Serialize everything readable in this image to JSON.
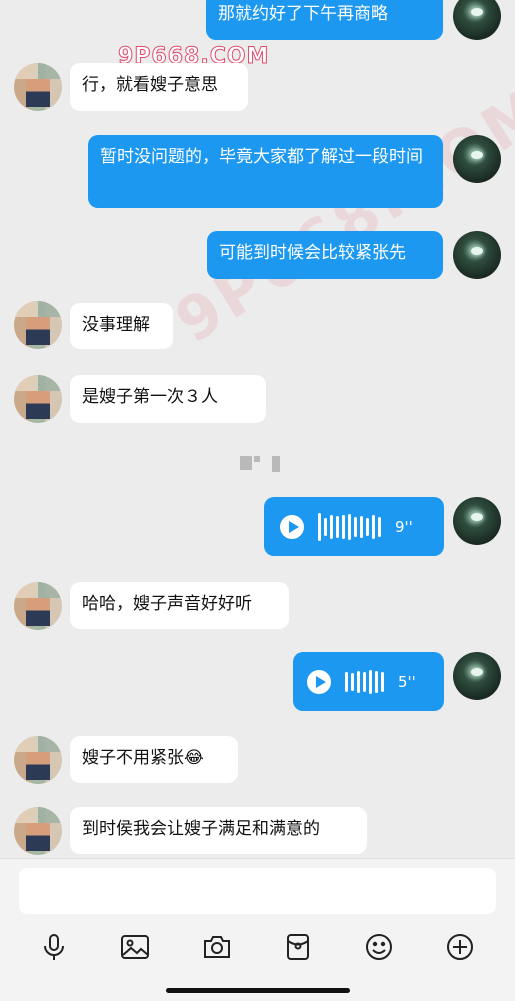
{
  "messages": [
    {
      "side": "out",
      "text": "那就约好了下午再商略"
    },
    {
      "side": "in",
      "text": "行，就看嫂子意思"
    },
    {
      "side": "out",
      "text": "暂时没问题的，毕竟大家都了解过一段时间"
    },
    {
      "side": "out",
      "text": "可能到时候会比较紧张先"
    },
    {
      "side": "in",
      "text": "没事理解"
    },
    {
      "side": "in",
      "text": "是嫂子第一次３人"
    },
    {
      "side": "out",
      "type": "voice",
      "duration": "9''"
    },
    {
      "side": "in",
      "text": "哈哈，嫂子声音好好听"
    },
    {
      "side": "out",
      "type": "voice",
      "duration": "5''"
    },
    {
      "side": "in",
      "text": "嫂子不用紧张😂"
    },
    {
      "side": "in",
      "text": "到时侯我会让嫂子满足和满意的"
    }
  ],
  "watermark": "9P668.COM",
  "watermark_diag": "9P668.COM",
  "toolbar": [
    "mic-icon",
    "image-icon",
    "camera-icon",
    "red-packet-icon",
    "emoji-icon",
    "plus-icon"
  ],
  "colors": {
    "outgoing": "#1d98f0",
    "incoming": "#ffffff",
    "background": "#ececec"
  }
}
